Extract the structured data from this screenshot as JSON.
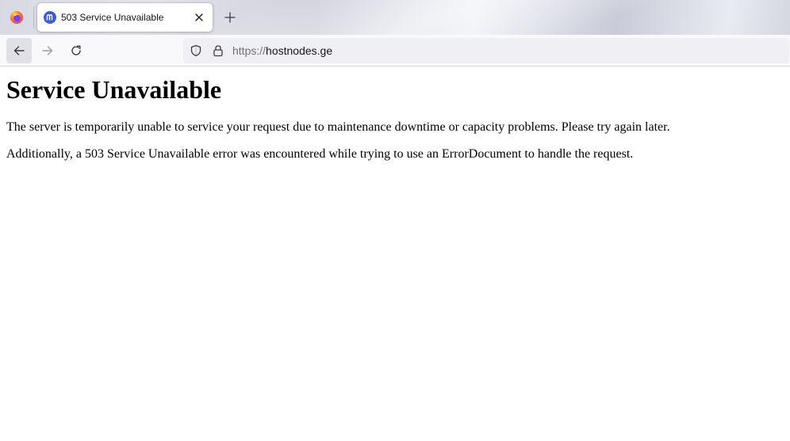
{
  "browser": {
    "tab": {
      "title": "503 Service Unavailable"
    },
    "url": {
      "scheme": "https://",
      "host": "hostnodes.ge"
    }
  },
  "page": {
    "heading": "Service Unavailable",
    "paragraphs": [
      "The server is temporarily unable to service your request due to maintenance downtime or capacity problems. Please try again later.",
      "Additionally, a 503 Service Unavailable error was encountered while trying to use an ErrorDocument to handle the request."
    ]
  },
  "icons": {
    "browser_menu": "firefox-icon",
    "favicon": "site-favicon-icon",
    "tab_close": "close-icon",
    "new_tab": "plus-icon",
    "back": "arrow-left-icon",
    "forward": "arrow-right-icon",
    "reload": "reload-icon",
    "tracking": "shield-icon",
    "security": "lock-icon"
  },
  "colors": {
    "favicon_blue": "#3b5bdb",
    "text": "#15141a",
    "url_scheme": "#6f6f77"
  }
}
